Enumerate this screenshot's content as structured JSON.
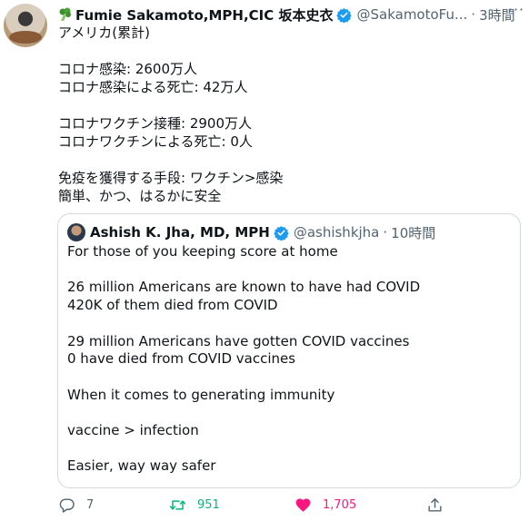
{
  "tweet": {
    "author_name": "Fumie Sakamoto,MPH,CIC 坂本史衣",
    "handle": "@SakamotoFu...",
    "separator": "·",
    "time": "3時間",
    "more": "···",
    "text": "アメリカ(累計)\n\nコロナ感染: 2600万人\nコロナ感染による死亡: 42万人\n\nコロナワクチン接種: 2900万人\nコロナワクチンによる死亡: 0人\n\n免疫を獲得する手段: ワクチン>感染\n簡単、かつ、はるかに安全"
  },
  "quote": {
    "author_name": "Ashish K. Jha, MD, MPH",
    "handle": "@ashishkjha",
    "separator": "·",
    "time": "10時間",
    "text": "For those of you keeping score at home\n\n26 million Americans are known to have had COVID\n420K of them died from COVID\n\n29 million Americans have gotten COVID vaccines\n0 have died from COVID vaccines\n\nWhen it comes to generating immunity\n\nvaccine > infection\n\nEasier, way way safer"
  },
  "actions": {
    "reply_count": "7",
    "retweet_count": "951",
    "like_count": "1,705"
  },
  "colors": {
    "verified": "#1d9bf0",
    "retweet_active": "#00ba7c",
    "like_active": "#f91880",
    "muted": "#536471"
  },
  "icons": [
    "broccoli-icon",
    "verified-badge-icon",
    "more-icon",
    "reply-icon",
    "retweet-icon",
    "heart-icon",
    "share-icon"
  ]
}
